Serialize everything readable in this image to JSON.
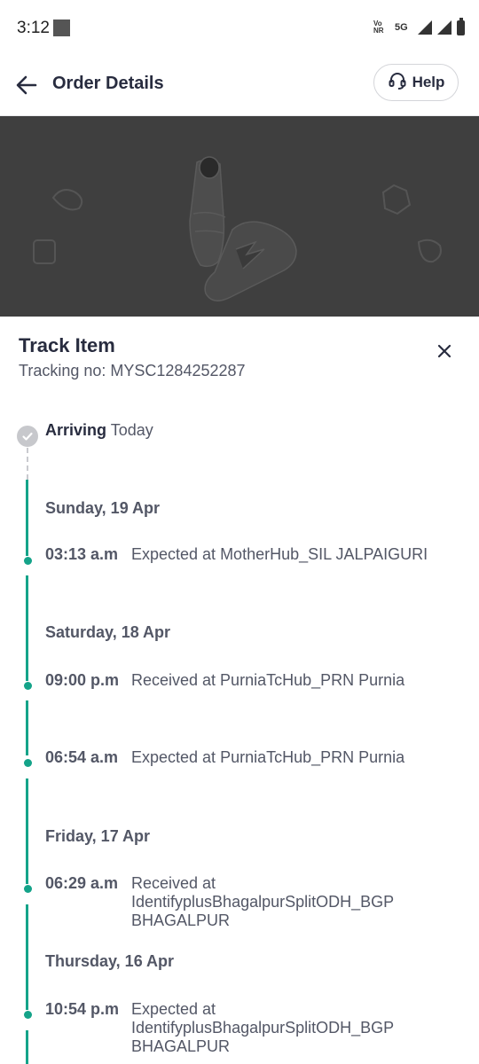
{
  "status_bar": {
    "time": "3:12",
    "volte": "Vo\nNR",
    "network": "5G"
  },
  "header": {
    "title": "Order Details",
    "help_label": "Help"
  },
  "product": {
    "image_icon": "sneakers-image"
  },
  "track_sheet": {
    "title": "Track Item",
    "tracking_label": "Tracking no:",
    "tracking_number": "MYSC1284252287",
    "arriving_label": "Arriving",
    "arriving_value": "Today",
    "groups": [
      {
        "date": "Sunday, 19 Apr",
        "events": [
          {
            "time": "03:13 a.m",
            "desc": "Expected at MotherHub_SIL JALPAIGURI"
          }
        ]
      },
      {
        "date": "Saturday, 18 Apr",
        "events": [
          {
            "time": "09:00 p.m",
            "desc": "Received at PurniaTcHub_PRN Purnia"
          },
          {
            "time": "06:54 a.m",
            "desc": "Expected at PurniaTcHub_PRN Purnia"
          }
        ]
      },
      {
        "date": "Friday, 17 Apr",
        "events": [
          {
            "time": "06:29 a.m",
            "desc": "Received at IdentifyplusBhagalpurSplitODH_BGP BHAGALPUR"
          }
        ]
      },
      {
        "date": "Thursday, 16 Apr",
        "events": [
          {
            "time": "10:54 p.m",
            "desc": "Expected at IdentifyplusBhagalpurSplitODH_BGP BHAGALPUR"
          }
        ]
      }
    ]
  },
  "colors": {
    "accent": "#14a389",
    "text_primary": "#282c3f",
    "text_secondary": "#535766",
    "overlay": "#3f3f3f"
  }
}
